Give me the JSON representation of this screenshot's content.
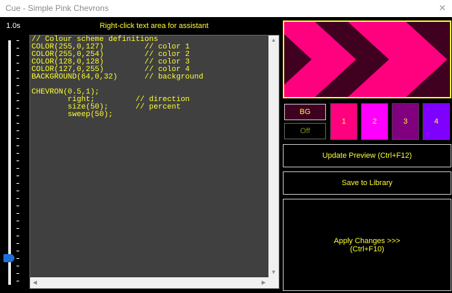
{
  "window": {
    "title": "Cue - Simple Pink Chevrons",
    "close_glyph": "✕"
  },
  "speed": {
    "label": "1.0s",
    "level": 0.91
  },
  "hint": "Right-click text area for assistant",
  "editor": {
    "lines": [
      "// Colour scheme definitions",
      "COLOR(255,0,127)         // color 1",
      "COLOR(255,0,254)         // color 2",
      "COLOR(128,0,128)         // color 3",
      "COLOR(127,0,255)         // color 4",
      "BACKGROUND(64,0,32)      // background",
      "",
      "CHEVRON(0.5,1);",
      "        right;         // direction",
      "        size(50);      // percent",
      "        sweep(50);"
    ]
  },
  "preview": {
    "colors": {
      "background": "#400020",
      "chevron": "#ff007f",
      "border": "#ffff33"
    }
  },
  "bg_button": {
    "label": "BG"
  },
  "off_button": {
    "label": "Off"
  },
  "color_buttons": [
    {
      "label": "1",
      "color": "#ff007f"
    },
    {
      "label": "2",
      "color": "#ff00fe"
    },
    {
      "label": "3",
      "color": "#800080"
    },
    {
      "label": "4",
      "color": "#7f00ff"
    }
  ],
  "actions": {
    "update": "Update Preview (Ctrl+F12)",
    "save": "Save to Library",
    "apply_line1": "Apply Changes >>>",
    "apply_line2": "(Ctrl+F10)"
  }
}
